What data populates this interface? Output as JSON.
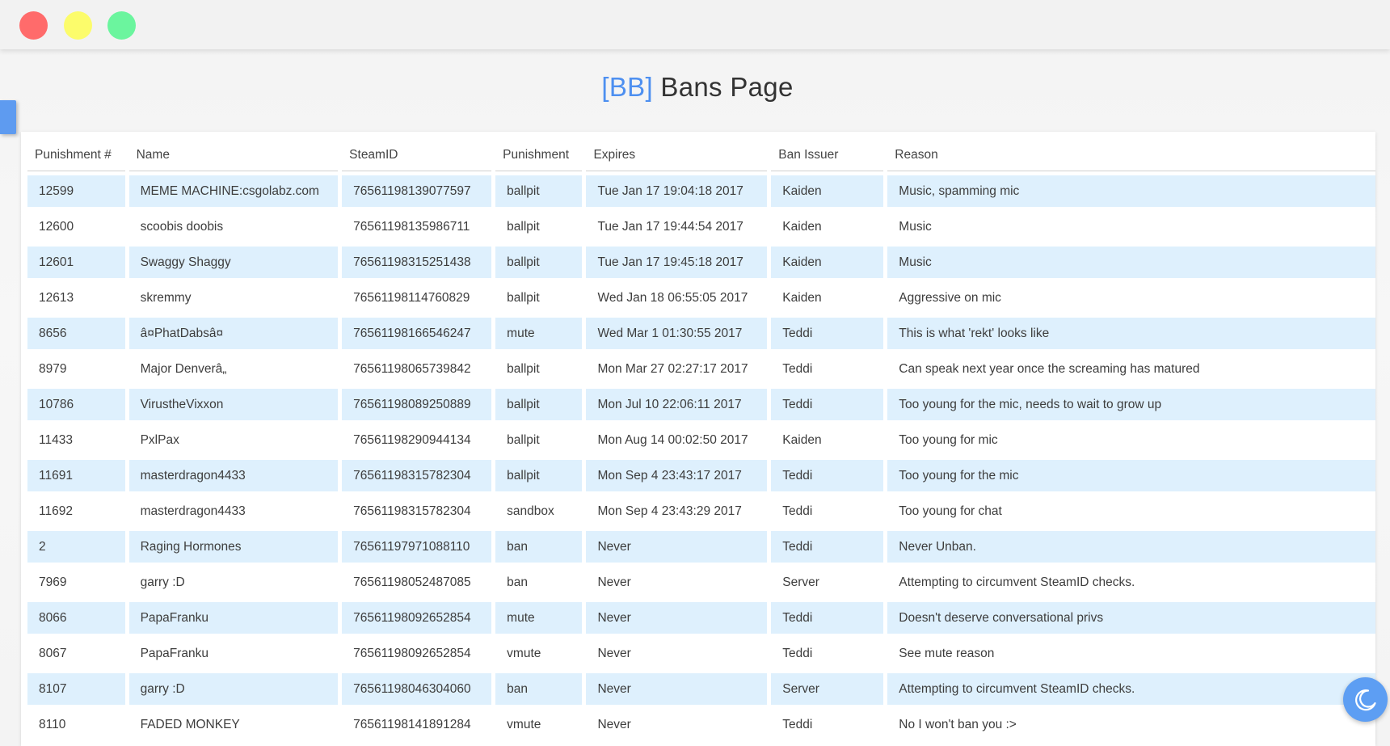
{
  "window": {
    "controls": [
      "close",
      "minimize",
      "maximize"
    ]
  },
  "title": {
    "tag": "[BB]",
    "text": " Bans Page"
  },
  "colors": {
    "accent": "#4d8ff0",
    "row_highlight": "#def0fd"
  },
  "table": {
    "headers": [
      "Punishment #",
      "Name",
      "SteamID",
      "Punishment",
      "Expires",
      "Ban Issuer",
      "Reason"
    ],
    "rows": [
      [
        "12599",
        "MEME MACHINE:csgolabz.com",
        "76561198139077597",
        "ballpit",
        "Tue Jan 17 19:04:18 2017",
        "Kaiden",
        "Music, spamming mic"
      ],
      [
        "12600",
        "scoobis doobis",
        "76561198135986711",
        "ballpit",
        "Tue Jan 17 19:44:54 2017",
        "Kaiden",
        "Music"
      ],
      [
        "12601",
        "Swaggy Shaggy",
        "76561198315251438",
        "ballpit",
        "Tue Jan 17 19:45:18 2017",
        "Kaiden",
        "Music"
      ],
      [
        "12613",
        "skremmy",
        "76561198114760829",
        "ballpit",
        "Wed Jan 18 06:55:05 2017",
        "Kaiden",
        "Aggressive on mic"
      ],
      [
        "8656",
        "â¤PhatDabsâ¤",
        "76561198166546247",
        "mute",
        "Wed Mar 1 01:30:55 2017",
        "Teddi",
        "This is what 'rekt' looks like"
      ],
      [
        "8979",
        "Major Denverâ„",
        "76561198065739842",
        "ballpit",
        "Mon Mar 27 02:27:17 2017",
        "Teddi",
        "Can speak next year once the screaming has matured"
      ],
      [
        "10786",
        "VirustheVixxon",
        "76561198089250889",
        "ballpit",
        "Mon Jul 10 22:06:11 2017",
        "Teddi",
        "Too young for the mic, needs to wait to grow up"
      ],
      [
        "11433",
        "PxlPax",
        "76561198290944134",
        "ballpit",
        "Mon Aug 14 00:02:50 2017",
        "Kaiden",
        "Too young for mic"
      ],
      [
        "11691",
        "masterdragon4433",
        "76561198315782304",
        "ballpit",
        "Mon Sep 4 23:43:17 2017",
        "Teddi",
        "Too young for the mic"
      ],
      [
        "11692",
        "masterdragon4433",
        "76561198315782304",
        "sandbox",
        "Mon Sep 4 23:43:29 2017",
        "Teddi",
        "Too young for chat"
      ],
      [
        "2",
        "Raging Hormones",
        "76561197971088110",
        "ban",
        "Never",
        "Teddi",
        "Never Unban."
      ],
      [
        "7969",
        "garry :D",
        "76561198052487085",
        "ban",
        "Never",
        "Server",
        "Attempting to circumvent SteamID checks."
      ],
      [
        "8066",
        "PapaFranku",
        "76561198092652854",
        "mute",
        "Never",
        "Teddi",
        "Doesn't deserve conversational privs"
      ],
      [
        "8067",
        "PapaFranku",
        "76561198092652854",
        "vmute",
        "Never",
        "Teddi",
        "See mute reason"
      ],
      [
        "8107",
        "garry :D",
        "76561198046304060",
        "ban",
        "Never",
        "Server",
        "Attempting to circumvent SteamID checks."
      ],
      [
        "8110",
        "FADED MONKEY",
        "76561198141891284",
        "vmute",
        "Never",
        "Teddi",
        "No I won't ban you :>"
      ]
    ]
  },
  "theme_toggle": {
    "icon": "moon-icon"
  }
}
